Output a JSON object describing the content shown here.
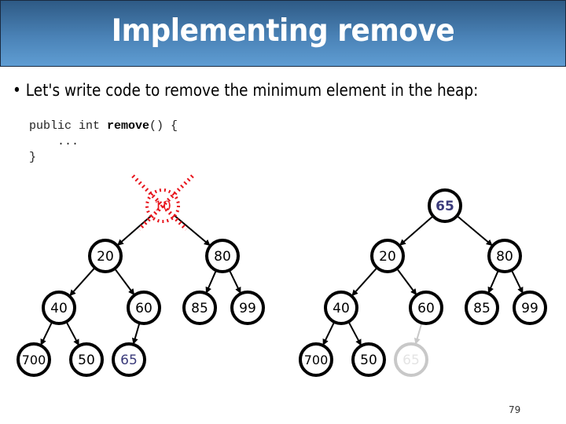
{
  "slide": {
    "title": "Implementing remove",
    "bullet": "Let's write code to remove the minimum element in the heap:",
    "code": {
      "line1_prefix": "public int ",
      "line1_method": "remove",
      "line1_suffix": "() {",
      "line2": "    ...",
      "line3": "}"
    },
    "page_number": "79"
  },
  "colors": {
    "title_bg_top": "#2e5a85",
    "title_bg_bottom": "#5f9dd3",
    "removed_red": "#e8141c",
    "moved_value": "#3a3a7a",
    "ghost_gray": "#c8c8c8"
  },
  "left_heap": {
    "removed_root": "10",
    "nodes": [
      "20",
      "80",
      "40",
      "60",
      "85",
      "99",
      "700",
      "50",
      "65"
    ]
  },
  "right_heap": {
    "root": "65",
    "nodes": [
      "20",
      "80",
      "40",
      "60",
      "85",
      "99",
      "700",
      "50"
    ],
    "ghost_node": "65"
  }
}
